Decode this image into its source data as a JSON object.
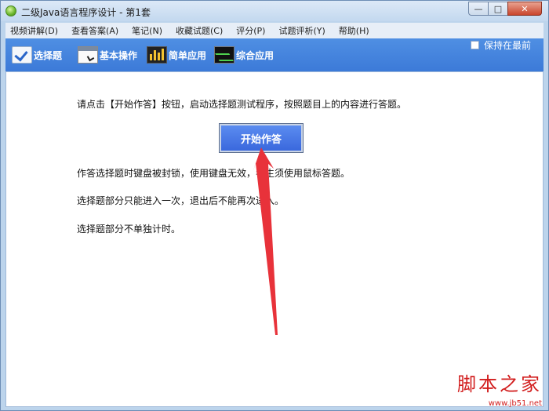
{
  "window": {
    "title": "二级Java语言程序设计 - 第1套",
    "controls": {
      "minimize": "—",
      "maximize": "□",
      "close": "✕"
    }
  },
  "menu": [
    "视频讲解(D)",
    "查看答案(A)",
    "笔记(N)",
    "收藏试题(C)",
    "评分(P)",
    "试题评析(Y)",
    "帮助(H)"
  ],
  "toolbar": {
    "items": [
      {
        "label": "选择题",
        "icon": "checklist-icon"
      },
      {
        "label": "基本操作",
        "icon": "window-cursor-icon"
      },
      {
        "label": "简单应用",
        "icon": "bar-chart-icon"
      },
      {
        "label": "综合应用",
        "icon": "waveform-icon"
      }
    ],
    "keep_on_top": {
      "label": "保持在最前",
      "checked": false
    }
  },
  "content": {
    "instruction": "请点击【开始作答】按钮，启动选择题测试程序，按照题目上的内容进行答题。",
    "start_button": "开始作答",
    "notes": [
      "作答选择题时键盘被封锁，使用键盘无效，考生须使用鼠标答题。",
      "选择题部分只能进入一次，退出后不能再次进入。",
      "选择题部分不单独计时。"
    ]
  },
  "watermark": {
    "title": "脚本之家",
    "url": "www.jb51.net"
  },
  "colors": {
    "toolbar": "#3f7ed9",
    "button": "#4a7be6",
    "arrow": "#e8323a",
    "watermark": "#d21e1e"
  }
}
